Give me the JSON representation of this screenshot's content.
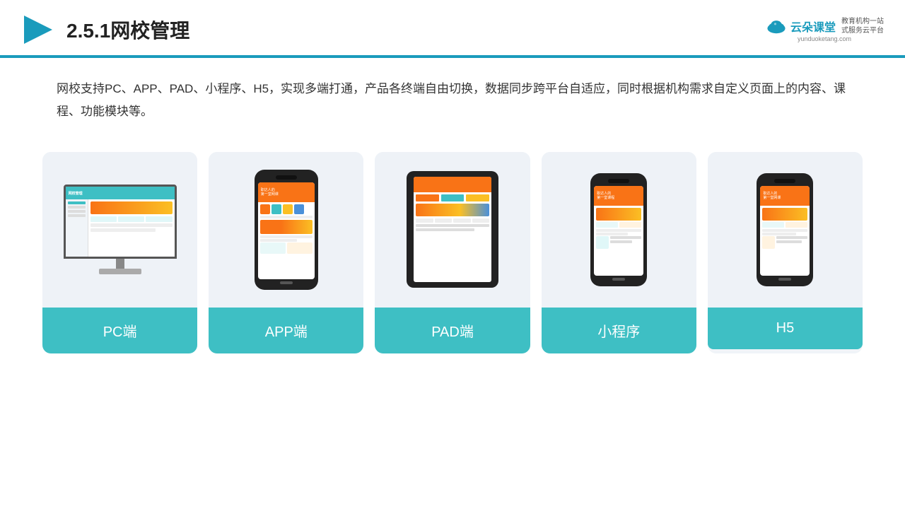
{
  "header": {
    "title": "2.5.1网校管理",
    "logo_text": "云朵课堂",
    "logo_url": "yunduoketang.com",
    "logo_slogan_line1": "教育机构一站",
    "logo_slogan_line2": "式服务云平台"
  },
  "description": {
    "text": "网校支持PC、APP、PAD、小程序、H5，实现多端打通，产品各终端自由切换，数据同步跨平台自适应，同时根据机构需求自定义页面上的内容、课程、功能模块等。"
  },
  "cards": [
    {
      "id": "pc",
      "label": "PC端"
    },
    {
      "id": "app",
      "label": "APP端"
    },
    {
      "id": "pad",
      "label": "PAD端"
    },
    {
      "id": "miniapp",
      "label": "小程序"
    },
    {
      "id": "h5",
      "label": "H5"
    }
  ],
  "colors": {
    "teal": "#3ebfc4",
    "accent": "#1a9bbc",
    "orange": "#f97316"
  }
}
